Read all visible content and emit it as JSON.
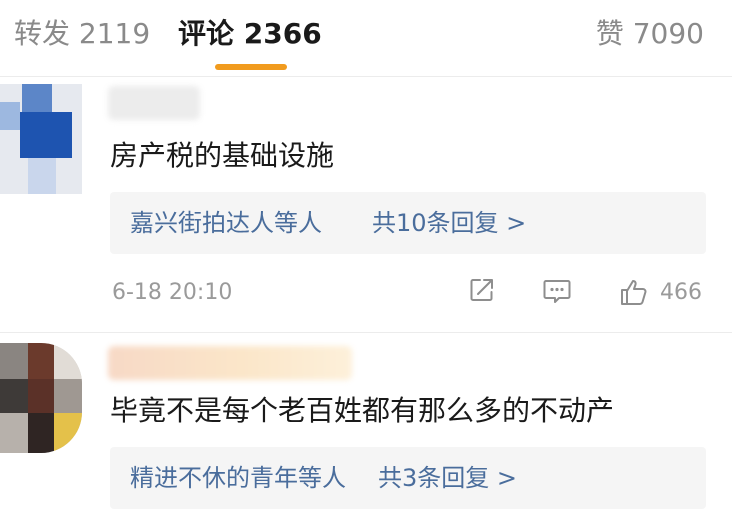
{
  "tabs": {
    "reposts": "转发 2119",
    "comments": "评论 2366",
    "likes": "赞 7090"
  },
  "colors": {
    "accent": "#f19b1e",
    "link": "#4a6d9c",
    "muted": "#9a9a9a"
  },
  "comments": [
    {
      "text": "房产税的基础设施",
      "reply_names": "嘉兴街拍达人等人",
      "reply_count": "共10条回复 >",
      "time": "6-18 20:10",
      "likes": "466"
    },
    {
      "text": "毕竟不是每个老百姓都有那么多的不动产",
      "reply_names": "精进不休的青年等人",
      "reply_count": "共3条回复 >"
    }
  ]
}
